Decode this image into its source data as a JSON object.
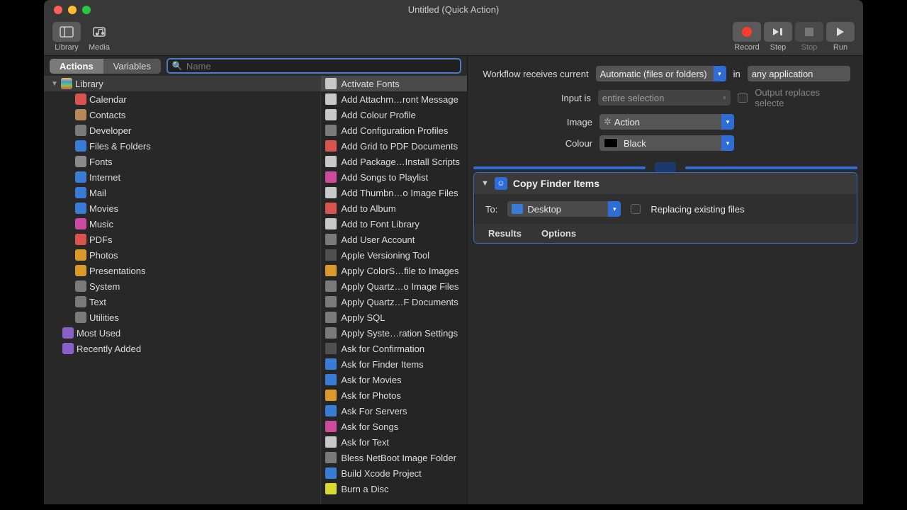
{
  "title": "Untitled (Quick Action)",
  "toolbar": {
    "library": "Library",
    "media": "Media",
    "record": "Record",
    "step": "Step",
    "stop": "Stop",
    "run": "Run"
  },
  "leftHeader": {
    "actions": "Actions",
    "variables": "Variables",
    "searchPlaceholder": "Name"
  },
  "tree": {
    "root": "Library",
    "cats": [
      "Calendar",
      "Contacts",
      "Developer",
      "Files & Folders",
      "Fonts",
      "Internet",
      "Mail",
      "Movies",
      "Music",
      "PDFs",
      "Photos",
      "Presentations",
      "System",
      "Text",
      "Utilities"
    ],
    "mostUsed": "Most Used",
    "recent": "Recently Added"
  },
  "catIconBg": [
    "#d9534f",
    "#b48a5a",
    "#7a7a7a",
    "#3a7bd5",
    "#8a8a8a",
    "#3a7bd5",
    "#3a7bd5",
    "#3a7bd5",
    "#cc4aa0",
    "#d9534f",
    "#d99a2b",
    "#d99a2b",
    "#7a7a7a",
    "#7a7a7a",
    "#7a7a7a"
  ],
  "actions": [
    "Activate Fonts",
    "Add Attachm…ront Message",
    "Add Colour Profile",
    "Add Configuration Profiles",
    "Add Grid to PDF Documents",
    "Add Package…Install Scripts",
    "Add Songs to Playlist",
    "Add Thumbn…o Image Files",
    "Add to Album",
    "Add to Font Library",
    "Add User Account",
    "Apple Versioning Tool",
    "Apply ColorS…file to Images",
    "Apply Quartz…o Image Files",
    "Apply Quartz…F Documents",
    "Apply SQL",
    "Apply Syste…ration Settings",
    "Ask for Confirmation",
    "Ask for Finder Items",
    "Ask for Movies",
    "Ask for Photos",
    "Ask For Servers",
    "Ask for Songs",
    "Ask for Text",
    "Bless NetBoot Image Folder",
    "Build Xcode Project",
    "Burn a Disc"
  ],
  "actIconBg": [
    "#c8c8c8",
    "#c8c8c8",
    "#c8c8c8",
    "#7a7a7a",
    "#d9534f",
    "#c8c8c8",
    "#cc4aa0",
    "#c8c8c8",
    "#d9534f",
    "#c8c8c8",
    "#7a7a7a",
    "#505050",
    "#d99a2b",
    "#7a7a7a",
    "#7a7a7a",
    "#7a7a7a",
    "#7a7a7a",
    "#505050",
    "#3a7bd5",
    "#3a7bd5",
    "#d99a2b",
    "#3a7bd5",
    "#cc4aa0",
    "#c8c8c8",
    "#7a7a7a",
    "#3a7bd5",
    "#d9d934"
  ],
  "config": {
    "receives": "Workflow receives current",
    "receivesVal": "Automatic (files or folders)",
    "in": "in",
    "app": "any application",
    "inputIs": "Input is",
    "inputVal": "entire selection",
    "image": "Image",
    "imageVal": "Action",
    "colour": "Colour",
    "colourVal": "Black",
    "outputReplaces": "Output replaces selecte"
  },
  "card": {
    "title": "Copy Finder Items",
    "to": "To:",
    "dest": "Desktop",
    "replace": "Replacing existing files",
    "results": "Results",
    "options": "Options"
  }
}
